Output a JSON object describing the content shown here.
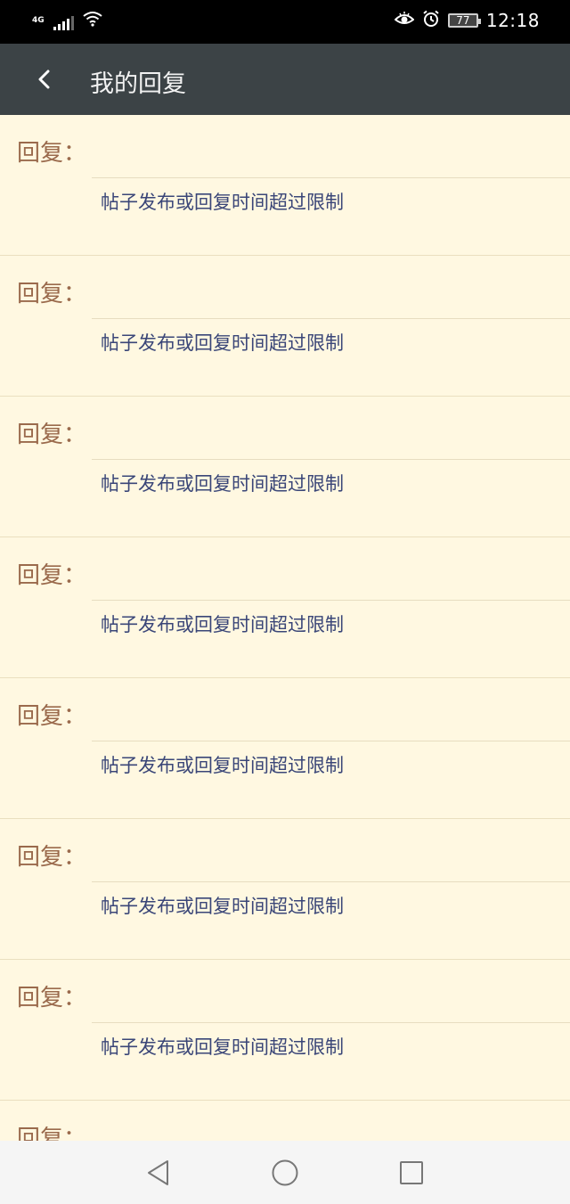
{
  "status_bar": {
    "network_type": "4G",
    "time": "12:18",
    "battery_level": "77",
    "icons": [
      "signal-icon",
      "wifi-icon",
      "eye-icon",
      "alarm-icon",
      "battery-icon"
    ]
  },
  "header": {
    "title": "我的回复"
  },
  "replies": [
    {
      "label": "回复：",
      "content": "帖子发布或回复时间超过限制"
    },
    {
      "label": "回复：",
      "content": "帖子发布或回复时间超过限制"
    },
    {
      "label": "回复：",
      "content": "帖子发布或回复时间超过限制"
    },
    {
      "label": "回复：",
      "content": "帖子发布或回复时间超过限制"
    },
    {
      "label": "回复：",
      "content": "帖子发布或回复时间超过限制"
    },
    {
      "label": "回复：",
      "content": "帖子发布或回复时间超过限制"
    },
    {
      "label": "回复：",
      "content": "帖子发布或回复时间超过限制"
    },
    {
      "label": "回复：",
      "content": ""
    }
  ],
  "nav_bar": {
    "icons": [
      "back-triangle-icon",
      "home-circle-icon",
      "recents-square-icon"
    ]
  },
  "colors": {
    "status_bar": "#000000",
    "app_bar": "#3c4346",
    "list_background": "#fff8e1",
    "reply_label": "#9a6a4c",
    "reply_content": "#3a4678",
    "nav_bar": "#f5f5f5"
  }
}
